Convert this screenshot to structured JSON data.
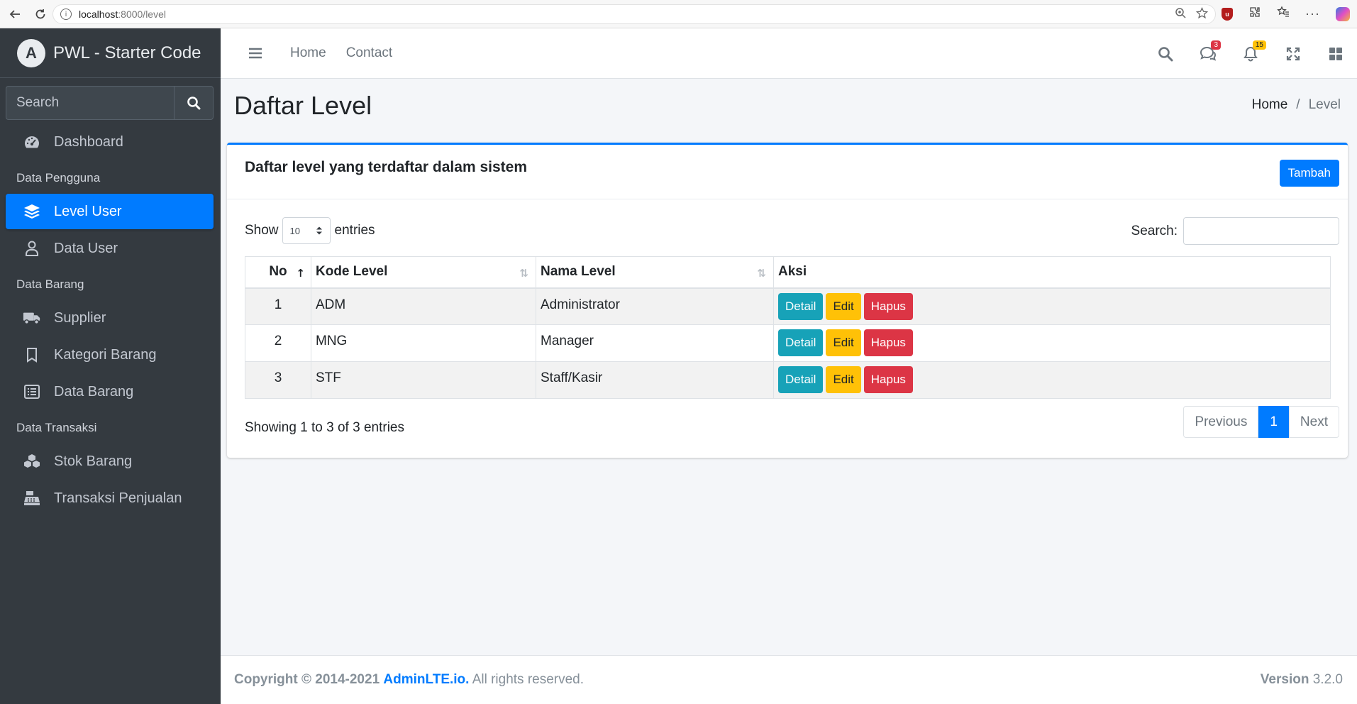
{
  "browser": {
    "url_host": "localhost",
    "url_path": ":8000/level"
  },
  "sidebar": {
    "brand": "PWL - Starter Code",
    "search_placeholder": "Search",
    "dashboard": "Dashboard",
    "header_pengguna": "Data Pengguna",
    "level_user": "Level User",
    "data_user": "Data User",
    "header_barang": "Data Barang",
    "supplier": "Supplier",
    "kategori_barang": "Kategori Barang",
    "data_barang": "Data Barang",
    "header_transaksi": "Data Transaksi",
    "stok_barang": "Stok Barang",
    "transaksi_penjualan": "Transaksi Penjualan"
  },
  "topnav": {
    "home": "Home",
    "contact": "Contact",
    "messages_count": "3",
    "notifications_count": "15"
  },
  "page": {
    "title": "Daftar Level",
    "breadcrumb_home": "Home",
    "breadcrumb_sep": "/",
    "breadcrumb_current": "Level"
  },
  "card": {
    "title": "Daftar level yang terdaftar dalam sistem",
    "add_button": "Tambah",
    "show_label": "Show",
    "entries_value": "10",
    "entries_label": "entries",
    "search_label": "Search:",
    "columns": {
      "no": "No",
      "kode": "Kode Level",
      "nama": "Nama Level",
      "aksi": "Aksi"
    },
    "rows": [
      {
        "no": "1",
        "kode": "ADM",
        "nama": "Administrator"
      },
      {
        "no": "2",
        "kode": "MNG",
        "nama": "Manager"
      },
      {
        "no": "3",
        "kode": "STF",
        "nama": "Staff/Kasir"
      }
    ],
    "btn_detail": "Detail",
    "btn_edit": "Edit",
    "btn_hapus": "Hapus",
    "info": "Showing 1 to 3 of 3 entries",
    "pager_prev": "Previous",
    "pager_current": "1",
    "pager_next": "Next"
  },
  "footer": {
    "copyright": "Copyright © 2014-2021",
    "brand_link": "AdminLTE.io.",
    "rights": "All rights reserved.",
    "version_label": "Version",
    "version_value": "3.2.0"
  },
  "colors": {
    "primary": "#007bff",
    "sidebar_bg": "#343a40",
    "info": "#17a2b8",
    "warning": "#ffc107",
    "danger": "#dc3545"
  }
}
